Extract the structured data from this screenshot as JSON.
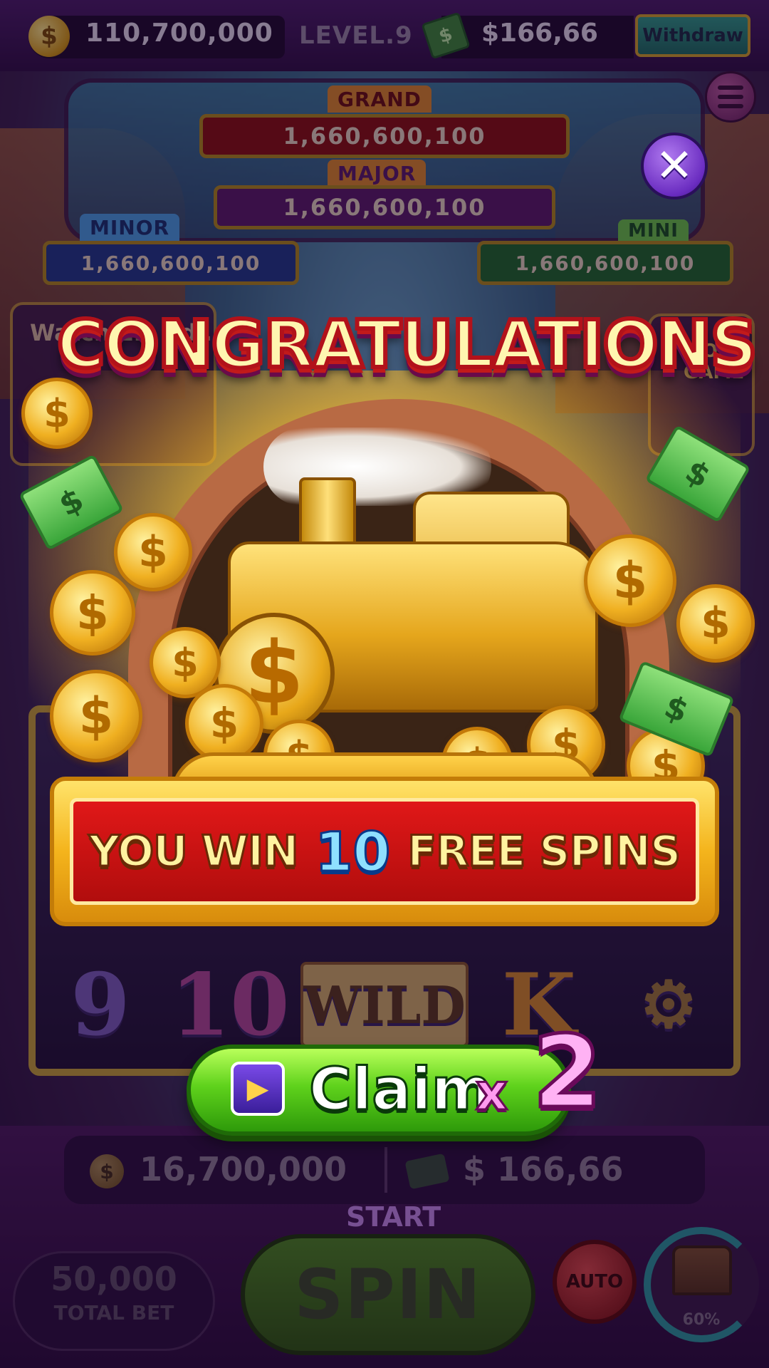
{
  "topbar": {
    "coins": "110,700,000",
    "coin_icon": "$",
    "level": "LEVEL.9",
    "cash": "$166,66",
    "cash_icon": "$",
    "withdraw_label": "Withdraw"
  },
  "jackpots": {
    "grand": {
      "label": "GRAND",
      "value": "1,660,600,100"
    },
    "major": {
      "label": "MAJOR",
      "value": "1,660,600,100"
    },
    "minor": {
      "label": "MINOR",
      "value": "1,660,600,100"
    },
    "mini": {
      "label": "MINI",
      "value": "1,660,600,100"
    }
  },
  "side": {
    "left_text": "Watch 2… ad…",
    "right_text": "MORE GAME"
  },
  "popup": {
    "title": "CONGRATULATIONS",
    "close_glyph": "✕",
    "train_symbol": "$",
    "coin_symbol": "$",
    "bill_symbol": "$",
    "win_prefix": "YOU WIN",
    "win_count": "10",
    "win_suffix": "FREE SPINS",
    "claim_label": "Claim",
    "claim_icon": "▶",
    "claim_mult_x": "x",
    "claim_mult_n": "2"
  },
  "reels": {
    "symbols": [
      "9",
      "10",
      "WILD",
      "K",
      "⚙"
    ]
  },
  "bottom": {
    "total_coins": "16,700,000",
    "coin_icon": "$",
    "total_cash": "$ 166,66",
    "start_label": "START",
    "bet_value": "50,000",
    "bet_label": "TOTAL BET",
    "spin_label": "SPIN",
    "auto_label": "AUTO",
    "chest_progress": "60%"
  },
  "colors": {
    "title_fill": "#fff6b0",
    "title_stroke": "#b2121a",
    "banner_red": "#e01818",
    "claim_green": "#5fd21c",
    "close_purple": "#6a2cc0"
  }
}
